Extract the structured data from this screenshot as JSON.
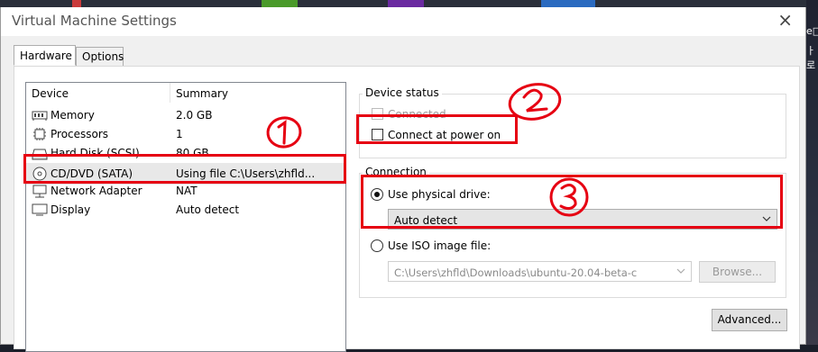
{
  "window": {
    "title": "Virtual Machine Settings",
    "close_glyph": "×"
  },
  "tabs": [
    {
      "label": "Hardware",
      "active": true
    },
    {
      "label": "Options",
      "active": false
    }
  ],
  "device_list": {
    "headers": {
      "device": "Device",
      "summary": "Summary"
    },
    "rows": [
      {
        "device": "Memory",
        "summary": "2.0 GB",
        "icon": "memory-icon"
      },
      {
        "device": "Processors",
        "summary": "1",
        "icon": "processor-icon"
      },
      {
        "device": "Hard Disk (SCSI)",
        "summary": "80 GB",
        "icon": "hard-disk-icon"
      },
      {
        "device": "CD/DVD (SATA)",
        "summary": "Using file C:\\Users\\zhfld...",
        "icon": "cd-dvd-icon",
        "selected": true
      },
      {
        "device": "Network Adapter",
        "summary": "NAT",
        "icon": "network-adapter-icon"
      },
      {
        "device": "Display",
        "summary": "Auto detect",
        "icon": "display-icon"
      }
    ]
  },
  "device_status": {
    "title": "Device status",
    "connected_label": "Connected",
    "connected_checked": false,
    "connect_power_on_label": "Connect at power on",
    "connect_power_on_checked": false
  },
  "connection": {
    "title": "Connection",
    "physical_label": "Use physical drive:",
    "physical_selected": true,
    "physical_value": "Auto detect",
    "iso_label": "Use ISO image file:",
    "iso_selected": false,
    "iso_path": "C:\\Users\\zhfld\\Downloads\\ubuntu-20.04-beta-c",
    "browse_label": "Browse..."
  },
  "advanced_label": "Advanced...",
  "desktop_glyphs": [
    "e□",
    "ㅏ 로"
  ],
  "annotations": {
    "one": "①",
    "two": "②",
    "three": "③"
  },
  "colors": {
    "annotation_red": "#e60012",
    "dialog_bg": "#f0f0f0"
  }
}
